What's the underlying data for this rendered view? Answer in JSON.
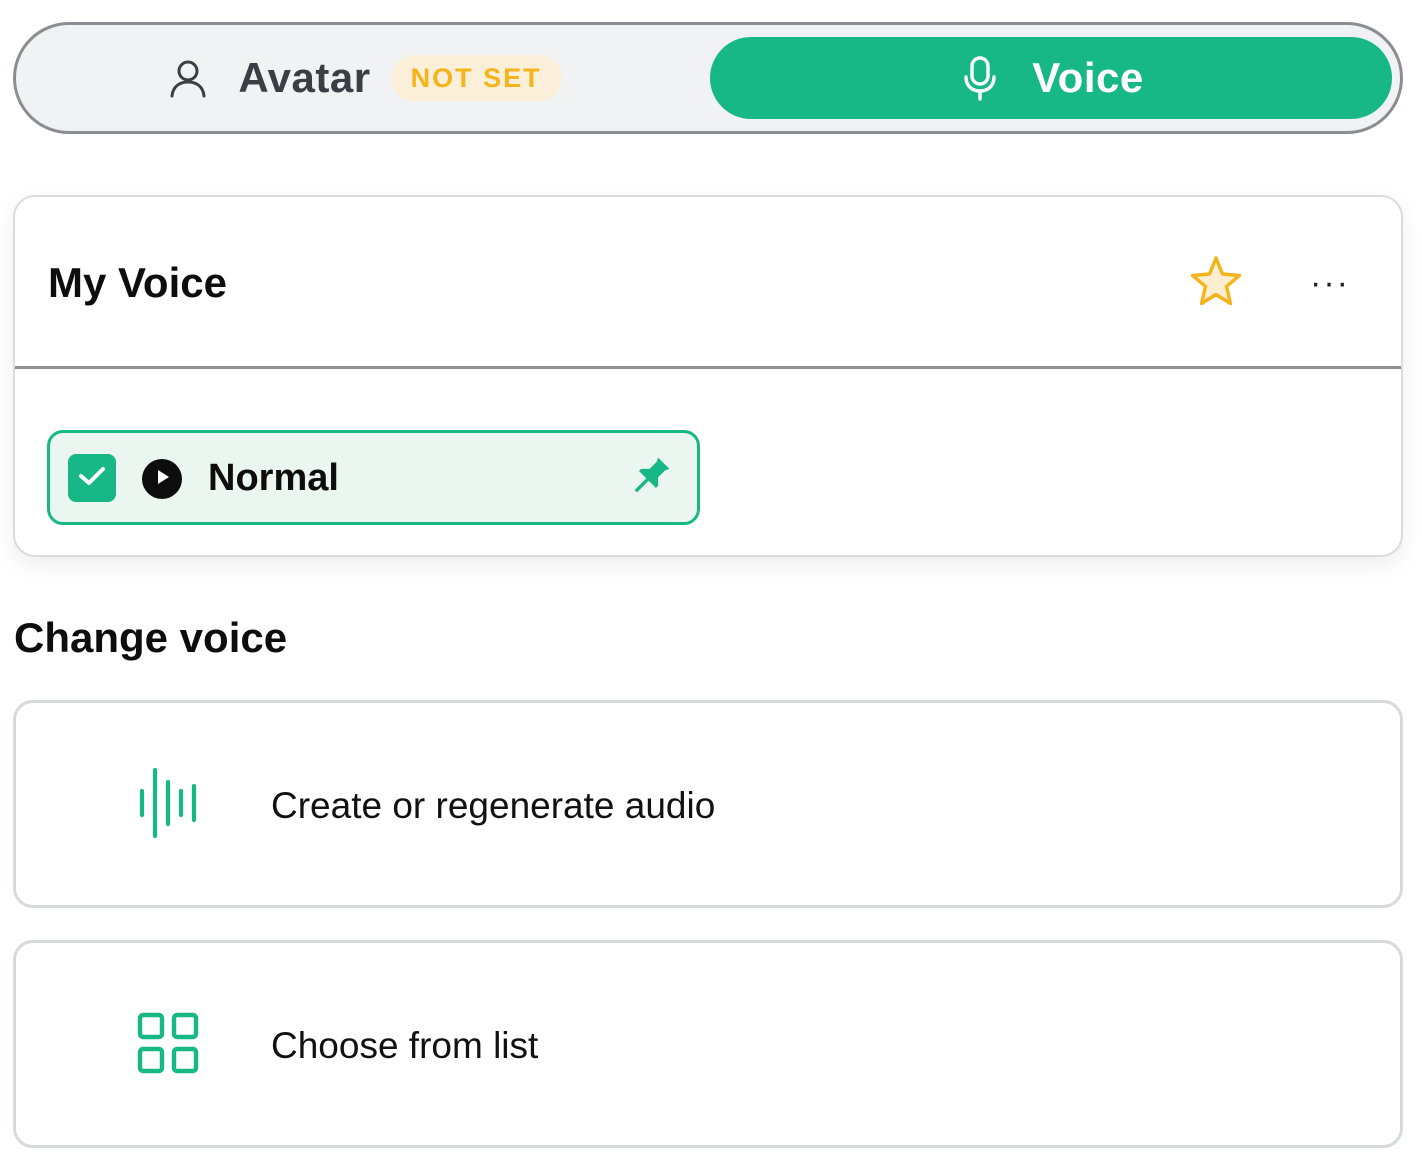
{
  "tabs": {
    "avatar": {
      "label": "Avatar",
      "icon": "user-icon",
      "badge": "NOT SET"
    },
    "voice": {
      "label": "Voice",
      "icon": "microphone-icon",
      "active": true
    }
  },
  "my_voice": {
    "title": "My Voice",
    "favorite_icon": "star-icon",
    "more_icon": "more-icon",
    "more_label": "···",
    "selected_voice": {
      "label": "Normal",
      "checked": true,
      "icons": [
        "checkbox-icon",
        "play-icon",
        "pin-icon"
      ]
    }
  },
  "change_voice": {
    "title": "Change voice",
    "options": [
      {
        "label": "Create or regenerate audio",
        "icon": "audio-waveform-icon"
      },
      {
        "label": "Choose from list",
        "icon": "grid-icon"
      }
    ]
  },
  "colors": {
    "accent": "#17b886",
    "badge_text": "#f4b41a",
    "badge_bg": "#fbefd9",
    "star": "#f4b41a",
    "chip_bg": "#eaf6ef"
  }
}
